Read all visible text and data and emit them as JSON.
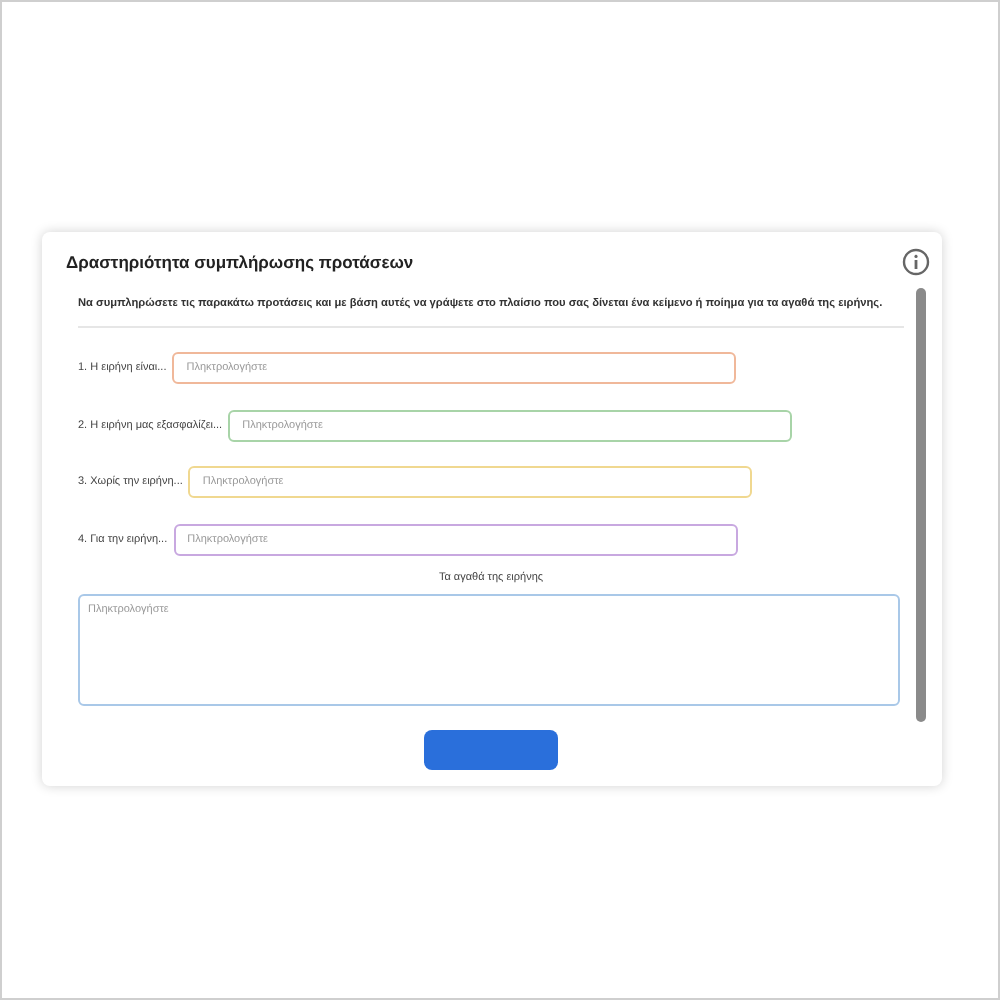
{
  "card": {
    "title": "Δραστηριότητα συμπλήρωσης προτάσεων"
  },
  "instructions": "Να συμπληρώσετε τις παρακάτω προτάσεις και με βάση αυτές να γράψετε στο πλαίσιο που σας δίνεται ένα κείμενο ή ποίημα για τα αγαθά της ειρήνης.",
  "sentences": [
    {
      "label": "1. Η ειρήνη είναι...",
      "placeholder": "Πληκτρολογήστε",
      "color": "#f0b89a"
    },
    {
      "label": "2. Η ειρήνη μας εξασφαλίζει...",
      "placeholder": "Πληκτρολογήστε",
      "color": "#a8d4a8"
    },
    {
      "label": "3. Χωρίς την ειρήνη...",
      "placeholder": "Πληκτρολογήστε",
      "color": "#f0d890"
    },
    {
      "label": "4. Για την ειρήνη...",
      "placeholder": "Πληκτρολογήστε",
      "color": "#c8a8e0"
    }
  ],
  "essay": {
    "label": "Τα αγαθά της ειρήνης",
    "placeholder": "Πληκτρολογήστε"
  }
}
